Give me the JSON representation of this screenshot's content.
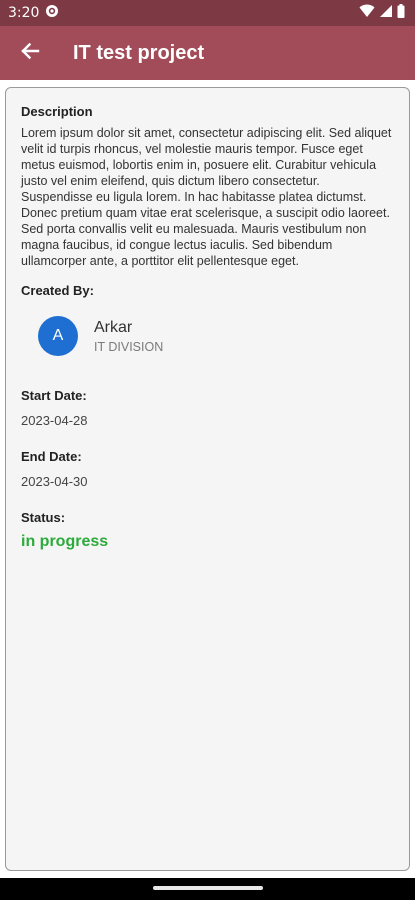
{
  "status_bar": {
    "time": "3:20",
    "icons": [
      "settings-icon",
      "wifi-icon",
      "signal-icon",
      "battery-icon"
    ]
  },
  "app_bar": {
    "title": "IT test project",
    "back_icon": "arrow-back-icon"
  },
  "project": {
    "description_label": "Description",
    "description": "Lorem ipsum dolor sit amet, consectetur adipiscing elit. Sed aliquet velit id turpis rhoncus, vel molestie mauris tempor. Fusce eget metus euismod, lobortis enim in, posuere elit. Curabitur vehicula justo vel enim eleifend, quis dictum libero consectetur. Suspendisse eu ligula lorem. In hac habitasse platea dictumst. Donec pretium quam vitae erat scelerisque, a suscipit odio laoreet. Sed porta convallis velit eu malesuada. Mauris vestibulum non magna faucibus, id congue lectus iaculis. Sed bibendum ullamcorper ante, a porttitor elit pellentesque eget.",
    "created_by_label": "Created By:",
    "creator": {
      "avatar_letter": "A",
      "name": "Arkar",
      "division": "IT DIVISION"
    },
    "start_date_label": "Start Date:",
    "start_date": "2023-04-28",
    "end_date_label": "End Date:",
    "end_date": "2023-04-30",
    "status_label": "Status:",
    "status": "in progress"
  },
  "colors": {
    "status_bar": "#7d3a45",
    "app_bar": "#a24c5a",
    "avatar": "#1e6fd1",
    "status_in_progress": "#2daa3c"
  }
}
